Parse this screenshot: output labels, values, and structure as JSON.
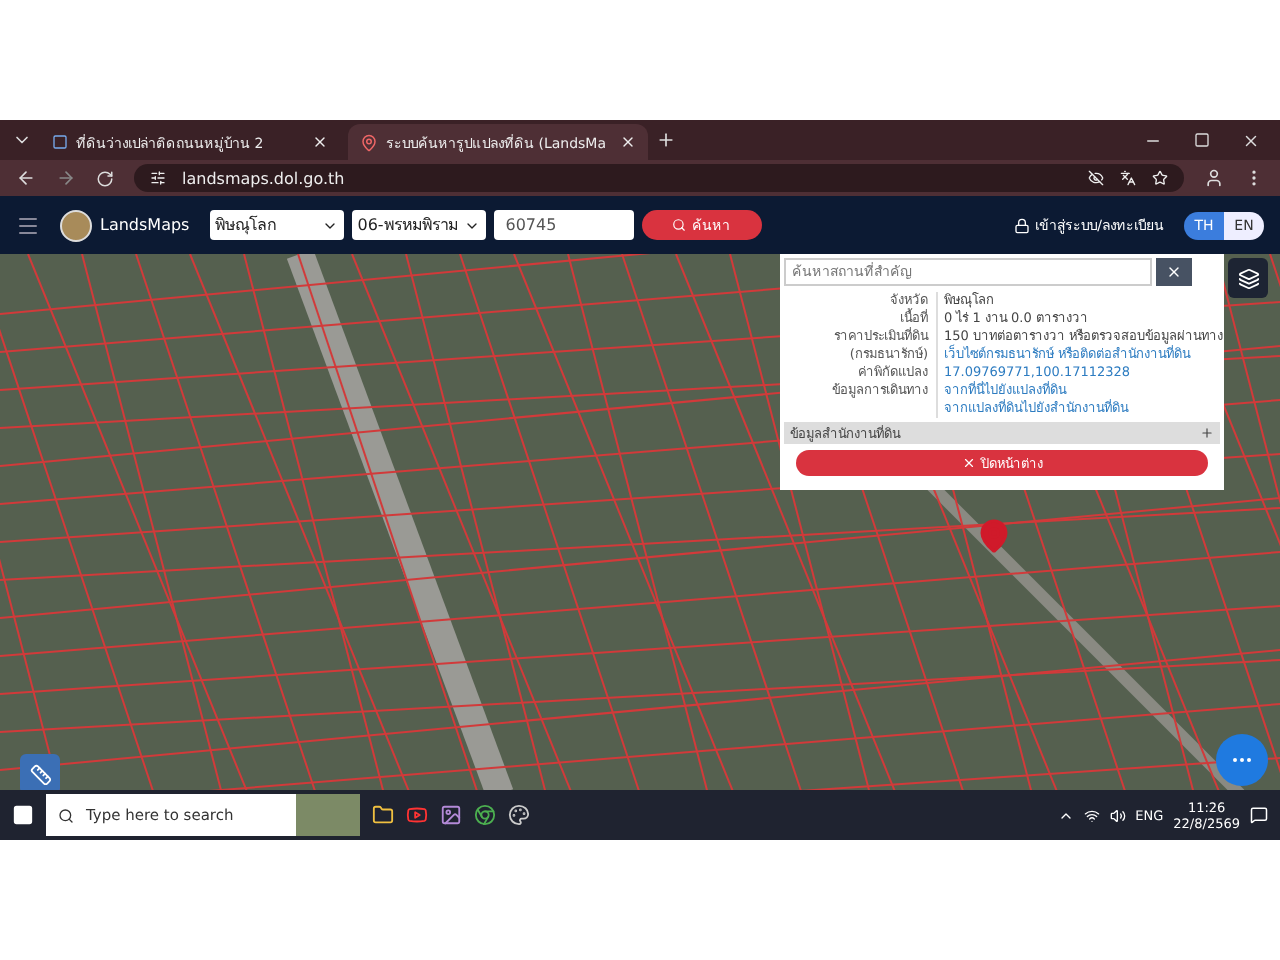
{
  "browser": {
    "tabs": [
      {
        "title": "ที่ดินว่างเปล่าติดถนนหมู่บ้าน 2",
        "selected": false
      },
      {
        "title": "ระบบค้นหารูปแปลงที่ดิน (LandsMa",
        "selected": true
      }
    ],
    "address": "landsmaps.dol.go.th"
  },
  "header": {
    "brand": "LandsMaps",
    "province": "พิษณุโลก",
    "district": "06-พรหมพิราม",
    "parcel_number": "60745",
    "search_button": "ค้นหา",
    "login": "เข้าสู่ระบบ/ลงทะเบียน",
    "languages": [
      {
        "label": "TH",
        "selected": true
      },
      {
        "label": "EN",
        "selected": false
      }
    ]
  },
  "popup": {
    "search_placeholder": "ค้นหาสถานที่สำคัญ",
    "rows": [
      {
        "label": "จังหวัด",
        "values": [
          {
            "text": "พิษณุโลก",
            "kind": "plain"
          }
        ]
      },
      {
        "label": "เนื้อที่",
        "values": [
          {
            "text": "0 ไร่ 1 งาน 0.0 ตารางวา",
            "kind": "plain"
          }
        ]
      },
      {
        "label": "ราคาประเมินที่ดิน",
        "values": [
          {
            "text": "150 บาทต่อตารางวา หรือตรวจสอบข้อมูลผ่านทาง",
            "kind": "plain"
          }
        ]
      },
      {
        "label": "(กรมธนารักษ์)",
        "values": [
          {
            "text": "เว็บไซต์กรมธนารักษ์ หรือติดต่อสำนักงานที่ดิน",
            "kind": "link"
          }
        ]
      },
      {
        "label": "ค่าพิกัดแปลง",
        "values": [
          {
            "text": "17.09769771,100.17112328",
            "kind": "link"
          }
        ]
      },
      {
        "label": "ข้อมูลการเดินทาง",
        "values": [
          {
            "text": "จากที่นี่ไปยังแปลงที่ดิน",
            "kind": "link"
          },
          {
            "text": "จากแปลงที่ดินไปยังสำนักงานที่ดิน",
            "kind": "link"
          }
        ]
      }
    ],
    "office_section": "ข้อมูลสำนักงานที่ดิน",
    "close_button": "ปิดหน้าต่าง"
  },
  "taskbar": {
    "search_placeholder": "Type here to search",
    "language": "ENG",
    "time": "11:26",
    "date": "22/8/2569"
  }
}
